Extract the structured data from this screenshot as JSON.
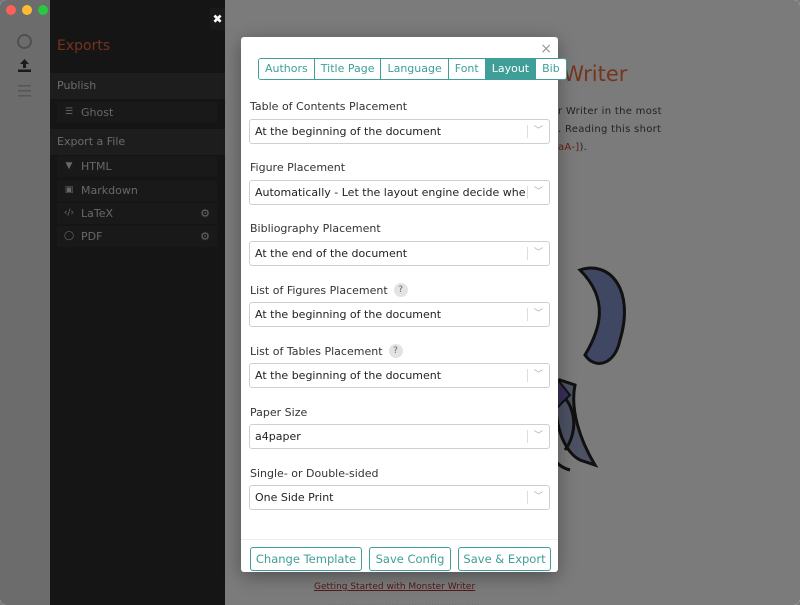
{
  "sidebar": {
    "title": "Exports",
    "publish_section": "Publish",
    "publish_items": [
      {
        "label": "Ghost",
        "icon": "sliders-icon"
      }
    ],
    "export_section": "Export a File",
    "export_items": [
      {
        "label": "HTML",
        "icon": "html5-icon"
      },
      {
        "label": "Markdown",
        "icon": "markdown-icon"
      },
      {
        "label": "LaTeX",
        "icon": "code-icon"
      },
      {
        "label": "PDF",
        "icon": "circle-icon"
      }
    ]
  },
  "document": {
    "title_fragment": "r Writer",
    "line1": "r Writer in the most",
    "line2": ". Reading this short",
    "line3_ref": "aA-]",
    "line3_tail": ").",
    "link": "Getting Started with Monster Writer"
  },
  "modal": {
    "close": "×",
    "tabs": [
      "Authors",
      "Title Page",
      "Language",
      "Font",
      "Layout",
      "Bib"
    ],
    "active_tab": "Layout",
    "fields": [
      {
        "label": "Table of Contents Placement",
        "value": "At the beginning of the document",
        "help": false
      },
      {
        "label": "Figure Placement",
        "value": "Automatically - Let the layout engine decide where to place",
        "help": false
      },
      {
        "label": "Bibliography Placement",
        "value": "At the end of the document",
        "help": false
      },
      {
        "label": "List of Figures Placement",
        "value": "At the beginning of the document",
        "help": true
      },
      {
        "label": "List of Tables Placement",
        "value": "At the beginning of the document",
        "help": true
      },
      {
        "label": "Paper Size",
        "value": "a4paper",
        "help": false
      },
      {
        "label": "Single- or Double-sided",
        "value": "One Side Print",
        "help": false
      }
    ],
    "help_glyph": "?",
    "buttons": {
      "change_template": "Change Template",
      "save_config": "Save Config",
      "save_export": "Save & Export"
    }
  },
  "colors": {
    "accent": "#3f9e97",
    "exports_title": "#e8663d"
  }
}
